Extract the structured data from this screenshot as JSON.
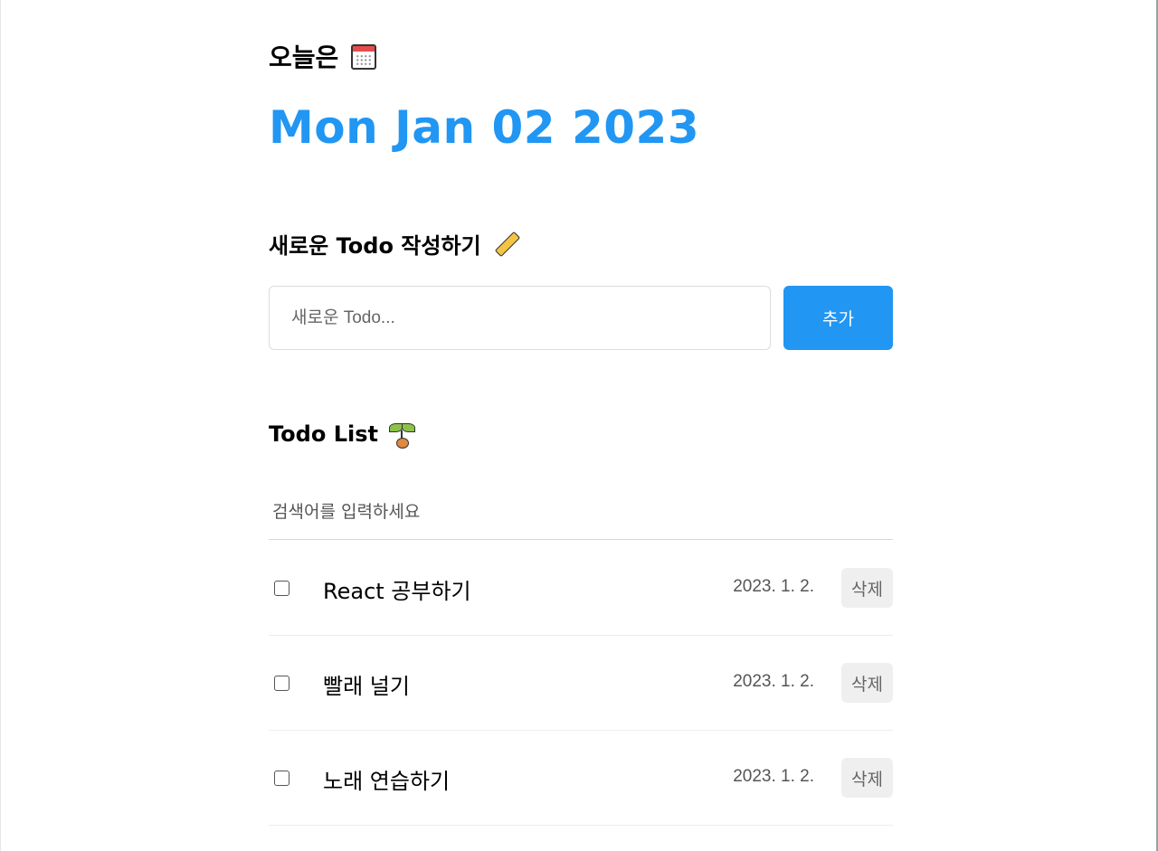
{
  "header": {
    "today_label": "오늘은",
    "date": "Mon Jan 02 2023"
  },
  "editor": {
    "title": "새로운 Todo 작성하기",
    "input_placeholder": "새로운 Todo...",
    "add_label": "추가"
  },
  "list": {
    "title": "Todo List",
    "search_placeholder": "검색어를 입력하세요",
    "items": [
      {
        "content": "React 공부하기",
        "date": "2023. 1. 2.",
        "delete_label": "삭제",
        "done": false
      },
      {
        "content": "빨래 널기",
        "date": "2023. 1. 2.",
        "delete_label": "삭제",
        "done": false
      },
      {
        "content": "노래 연습하기",
        "date": "2023. 1. 2.",
        "delete_label": "삭제",
        "done": false
      }
    ]
  },
  "icons": {
    "today": "calendar-icon",
    "editor": "pencil-icon",
    "list": "sprout-icon"
  },
  "colors": {
    "accent": "#2196f3",
    "delete_bg": "#efefef"
  }
}
